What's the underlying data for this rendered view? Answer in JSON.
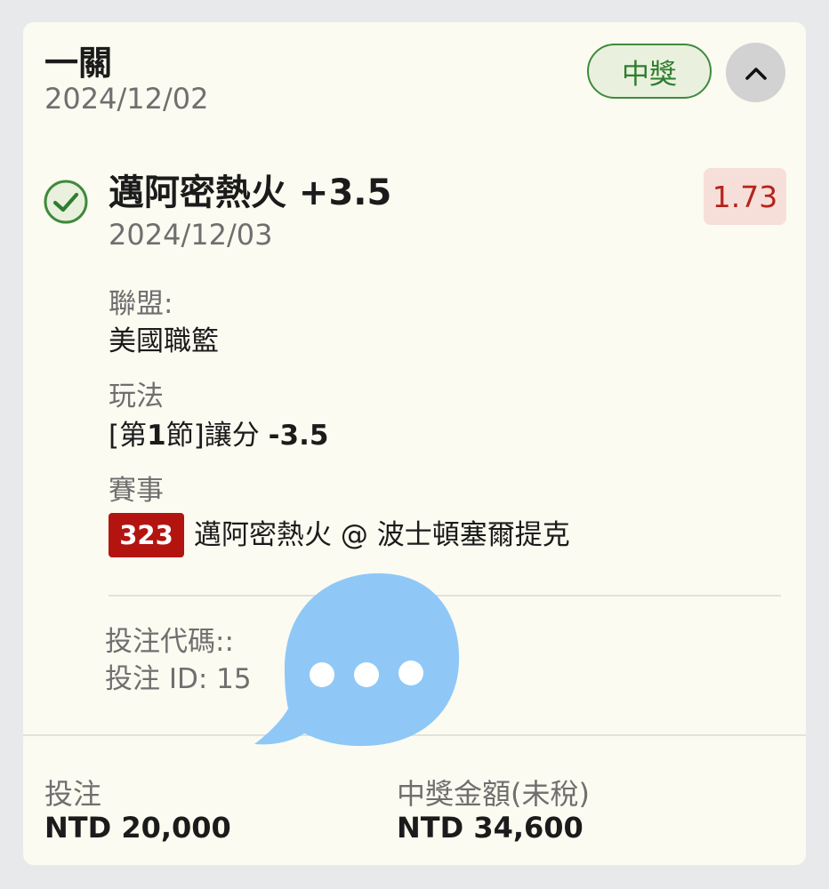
{
  "header": {
    "title": "一關",
    "date": "2024/12/02",
    "status_badge": "中獎"
  },
  "selection": {
    "team_line": "邁阿密熱火 +3.5",
    "odds": "1.73",
    "event_date": "2024/12/03",
    "league_label": "聯盟:",
    "league_value": "美國職籃",
    "market_label": "玩法",
    "market_value_prefix": "[第",
    "market_value_num": "1",
    "market_value_mid": "節]讓分 ",
    "market_value_line": "-3.5",
    "event_label": "賽事",
    "match_number": "323",
    "matchup": "邁阿密熱火 @ 波士頓塞爾提克"
  },
  "ticket": {
    "code_label": "投注代碼::",
    "id_label": "投注 ID: 15"
  },
  "summary": {
    "stake_label": "投注",
    "stake_value": "NTD 20,000",
    "payout_label": "中獎金額(未稅)",
    "payout_value": "NTD 34,600"
  },
  "colors": {
    "win_green": "#3f8a3c",
    "odds_red": "#b3241d",
    "match_red": "#b3140f",
    "chat_blue": "#8fc8f7"
  },
  "icons": {
    "check": "check-circle-icon",
    "collapse": "chevron-up-icon",
    "chat": "chat-bubble-icon"
  }
}
